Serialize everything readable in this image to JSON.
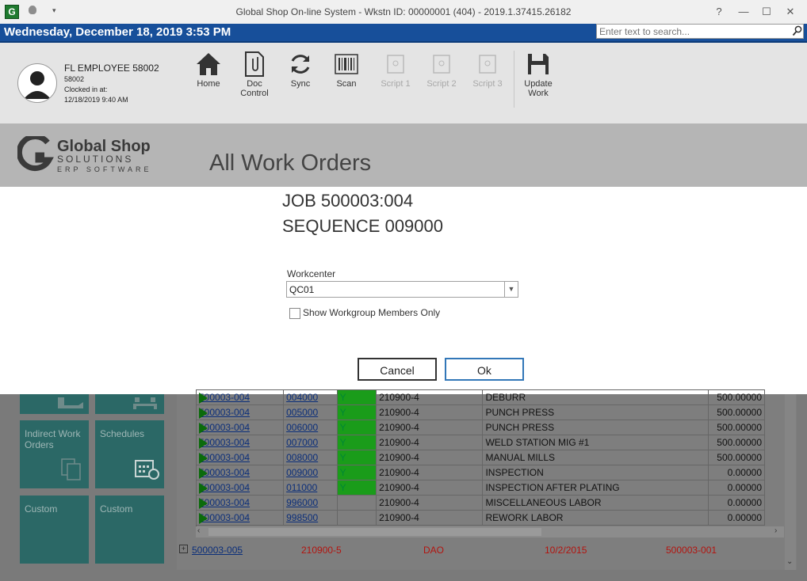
{
  "window": {
    "title": "Global Shop On-line System - Wkstn ID: 00000001 (404) - 2019.1.37415.26182",
    "help": "?",
    "minimize": "—",
    "maximize": "☐",
    "close": "✕"
  },
  "bluebar": {
    "date": "Wednesday, December 18, 2019 3:53 PM",
    "search_placeholder": "Enter text to search..."
  },
  "employee": {
    "name": "FL EMPLOYEE 58002",
    "id": "58002",
    "clocked_label": "Clocked in at:",
    "clocked_time": "12/18/2019 9:40 AM"
  },
  "toolbar": {
    "home": "Home",
    "doc1": "Doc",
    "doc2": "Control",
    "sync": "Sync",
    "scan": "Scan",
    "script1": "Script 1",
    "script2": "Script 2",
    "script3": "Script 3",
    "update1": "Update",
    "update2": "Work"
  },
  "logo": {
    "line1": "Global Shop",
    "line2": "SOLUTIONS",
    "line3": "ERP SOFTWARE"
  },
  "page_title": "All Work Orders",
  "dialog": {
    "job": "JOB  500003:004",
    "sequence": "SEQUENCE 009000",
    "workcenter_label": "Workcenter",
    "workcenter_value": "QC01",
    "checkbox_label": "Show Workgroup Members Only",
    "cancel": "Cancel",
    "ok": "Ok"
  },
  "tiles": {
    "indirect1": "Indirect Work",
    "indirect2": "Orders",
    "schedules": "Schedules",
    "custom1": "Custom",
    "custom2": "Custom"
  },
  "rows": [
    {
      "job": "500003-004",
      "seq": "004000",
      "flag": "Y",
      "part": "210900-4",
      "desc": "DEBURR",
      "qty": "500.00000"
    },
    {
      "job": "500003-004",
      "seq": "005000",
      "flag": "Y",
      "part": "210900-4",
      "desc": "PUNCH PRESS",
      "qty": "500.00000"
    },
    {
      "job": "500003-004",
      "seq": "006000",
      "flag": "Y",
      "part": "210900-4",
      "desc": "PUNCH PRESS",
      "qty": "500.00000"
    },
    {
      "job": "500003-004",
      "seq": "007000",
      "flag": "Y",
      "part": "210900-4",
      "desc": "WELD STATION MIG #1",
      "qty": "500.00000"
    },
    {
      "job": "500003-004",
      "seq": "008000",
      "flag": "Y",
      "part": "210900-4",
      "desc": "MANUAL MILLS",
      "qty": "500.00000"
    },
    {
      "job": "500003-004",
      "seq": "009000",
      "flag": "Y",
      "part": "210900-4",
      "desc": "INSPECTION",
      "qty": "0.00000"
    },
    {
      "job": "500003-004",
      "seq": "011000",
      "flag": "Y",
      "part": "210900-4",
      "desc": "INSPECTION AFTER PLATING",
      "qty": "0.00000"
    },
    {
      "job": "500003-004",
      "seq": "996000",
      "flag": "",
      "part": "210900-4",
      "desc": "MISCELLANEOUS LABOR",
      "qty": "0.00000"
    },
    {
      "job": "500003-004",
      "seq": "998500",
      "flag": "",
      "part": "210900-4",
      "desc": "REWORK LABOR",
      "qty": "0.00000"
    }
  ],
  "parent_row": {
    "job": "500003-005",
    "part": "210900-5",
    "customer": "DAO",
    "date": "10/2/2015",
    "ref": "500003-001"
  }
}
